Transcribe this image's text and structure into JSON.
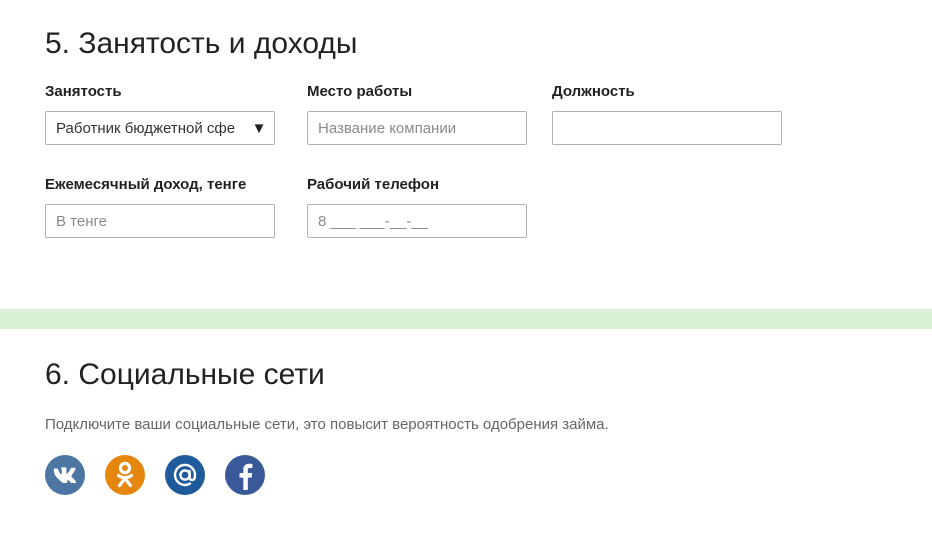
{
  "section5": {
    "title": "5. Занятость и доходы",
    "employment": {
      "label": "Занятость",
      "selected": "Работник бюджетной сфе"
    },
    "workplace": {
      "label": "Место работы",
      "placeholder": "Название компании"
    },
    "position": {
      "label": "Должность",
      "placeholder": ""
    },
    "income": {
      "label": "Ежемесячный доход, тенге",
      "placeholder": "В тенге"
    },
    "work_phone": {
      "label": "Рабочий телефон",
      "placeholder": "8 ___ ___-__-__"
    }
  },
  "section6": {
    "title": "6. Социальные сети",
    "description": "Подключите ваши социальные сети, это повысит вероятность одобрения займа.",
    "networks": [
      {
        "name": "vk-icon",
        "color": "#4e76a3"
      },
      {
        "name": "odnoklassniki-icon",
        "color": "#e5870f"
      },
      {
        "name": "mail-at-icon",
        "color": "#1f5a9b"
      },
      {
        "name": "facebook-icon",
        "color": "#3a5998"
      }
    ]
  },
  "colors": {
    "divider_band": "#d9f1d6",
    "field_border": "#aeb3b8"
  }
}
